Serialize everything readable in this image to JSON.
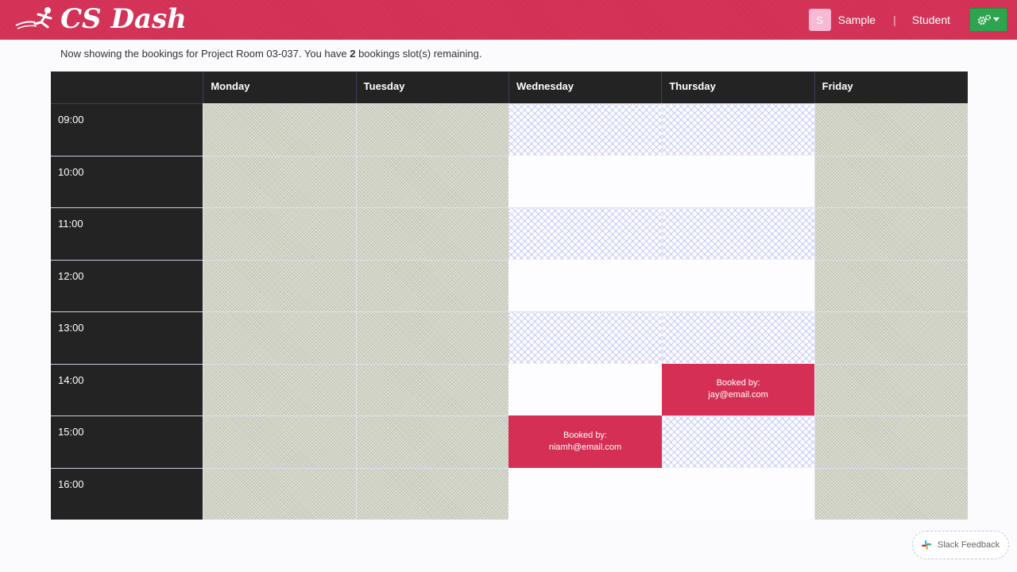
{
  "nav": {
    "brand": "CS Dash",
    "avatar_letter": "S",
    "user_name": "Sample",
    "separator": "|",
    "role": "Student",
    "settings_icon": "cogs-icon",
    "colors": {
      "brand": "#d62f55",
      "settings": "#2ea44f"
    }
  },
  "info": {
    "prefix": "Now showing the bookings for Project Room 03-037. You have ",
    "remaining": "2",
    "suffix": " bookings slot(s) remaining."
  },
  "calendar": {
    "days": [
      "Monday",
      "Tuesday",
      "Wednesday",
      "Thursday",
      "Friday"
    ],
    "times": [
      "09:00",
      "10:00",
      "11:00",
      "12:00",
      "13:00",
      "14:00",
      "15:00",
      "16:00"
    ],
    "slot_states": [
      [
        "unavailable",
        "unavailable",
        "hatched",
        "hatched",
        "unavailable"
      ],
      [
        "unavailable",
        "unavailable",
        "free",
        "free",
        "unavailable"
      ],
      [
        "unavailable",
        "unavailable",
        "hatched",
        "hatched",
        "unavailable"
      ],
      [
        "unavailable",
        "unavailable",
        "free",
        "free",
        "unavailable"
      ],
      [
        "unavailable",
        "unavailable",
        "hatched",
        "hatched",
        "unavailable"
      ],
      [
        "unavailable",
        "unavailable",
        "free",
        "booked",
        "unavailable"
      ],
      [
        "unavailable",
        "unavailable",
        "booked",
        "hatched",
        "unavailable"
      ],
      [
        "unavailable",
        "unavailable",
        "free",
        "free",
        "unavailable"
      ]
    ],
    "bookings": [
      {
        "day": "Thursday",
        "time": "14:00",
        "label": "Booked by:",
        "email": "jay@email.com"
      },
      {
        "day": "Wednesday",
        "time": "15:00",
        "label": "Booked by:",
        "email": "niamh@email.com"
      }
    ]
  },
  "feedback": {
    "label": "Slack Feedback",
    "icon": "slack-icon"
  }
}
